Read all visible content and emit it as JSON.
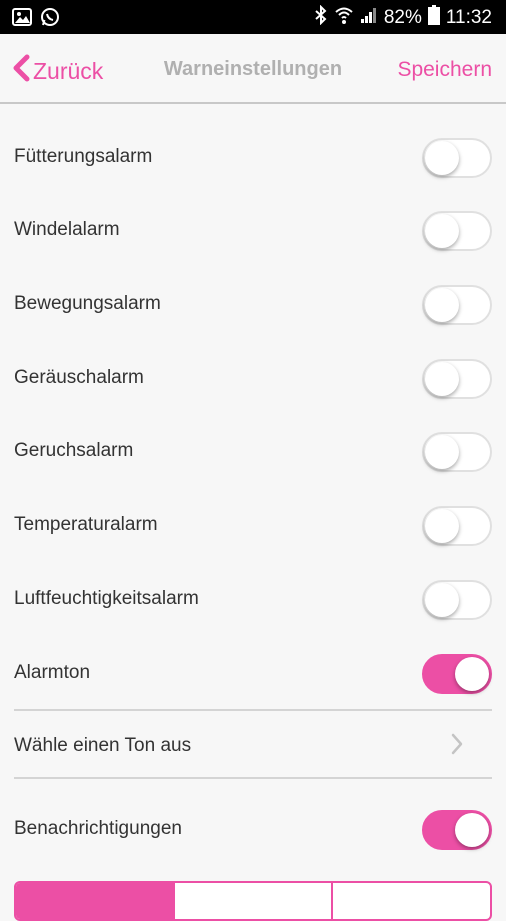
{
  "status_bar": {
    "battery": "82%",
    "time": "11:32",
    "icons": [
      "image-icon",
      "whatsapp-icon",
      "bluetooth-icon",
      "wifi-icon",
      "signal-icon",
      "battery-icon"
    ]
  },
  "nav": {
    "back_label": "Zurück",
    "title": "Warneinstellungen",
    "save_label": "Speichern"
  },
  "settings": [
    {
      "label": "Fütterungsalarm",
      "enabled": false
    },
    {
      "label": "Windelalarm",
      "enabled": false
    },
    {
      "label": "Bewegungsalarm",
      "enabled": false
    },
    {
      "label": "Geräuschalarm",
      "enabled": false
    },
    {
      "label": "Geruchsalarm",
      "enabled": false
    },
    {
      "label": "Temperaturalarm",
      "enabled": false
    },
    {
      "label": "Luftfeuchtigkeitsalarm",
      "enabled": false
    },
    {
      "label": "Alarmton",
      "enabled": true
    }
  ],
  "tone_select": {
    "label": "Wähle einen Ton aus"
  },
  "notifications": {
    "label": "Benachrichtigungen",
    "enabled": true
  },
  "colors": {
    "accent": "#ec4fa5",
    "background": "#f7f7f7",
    "title": "#b0b0b0"
  }
}
